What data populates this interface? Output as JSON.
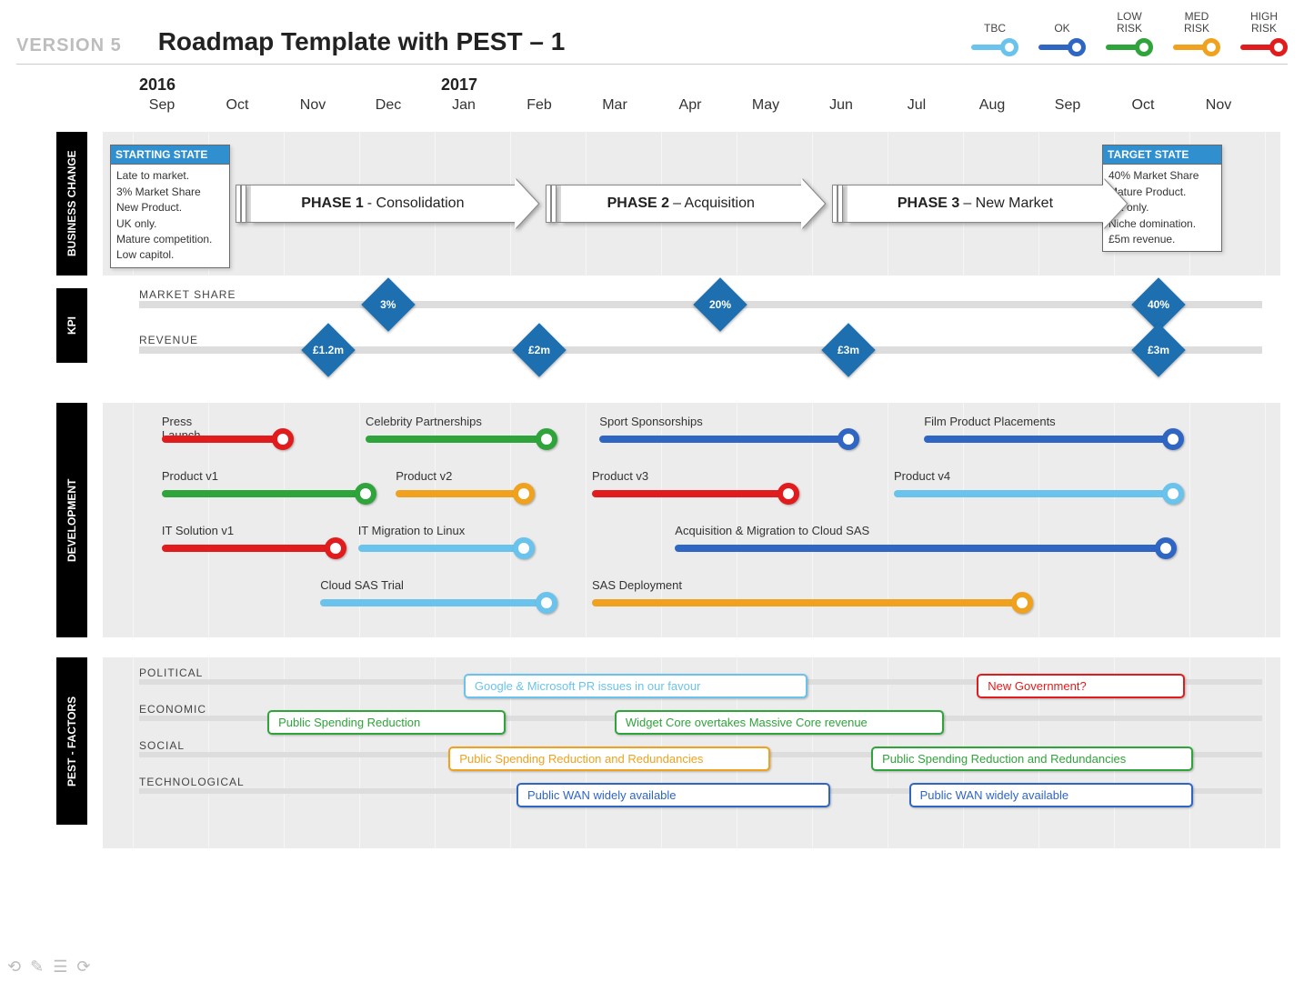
{
  "header": {
    "version": "VERSION 5",
    "title": "Roadmap Template with PEST – 1",
    "legend": [
      {
        "label": "TBC",
        "color": "#6ac3ec"
      },
      {
        "label": "OK",
        "color": "#2f66c4"
      },
      {
        "label": "LOW\nRISK",
        "color": "#2fa43a"
      },
      {
        "label": "MED\nRISK",
        "color": "#f0a21e"
      },
      {
        "label": "HIGH\nRISK",
        "color": "#e21c1c"
      }
    ]
  },
  "timeline": {
    "years": [
      {
        "label": "2016",
        "col": 0
      },
      {
        "label": "2017",
        "col": 4
      }
    ],
    "months": [
      "Sep",
      "Oct",
      "Nov",
      "Dec",
      "Jan",
      "Feb",
      "Mar",
      "Apr",
      "May",
      "Jun",
      "Jul",
      "Aug",
      "Sep",
      "Oct",
      "Nov"
    ]
  },
  "sections": {
    "business_change": {
      "label": "BUSINESS CHANGE",
      "starting_state": {
        "title": "STARTING STATE",
        "body": "Late to market.\n3% Market Share\nNew Product.\nUK only.\nMature competition.\nLow capitol."
      },
      "target_state": {
        "title": "TARGET STATE",
        "body": "40% Market Share\nMature Product.\nUK only.\nNiche domination.\n£5m revenue."
      },
      "phases": [
        {
          "name": "PHASE 1",
          "desc": " - Consolidation",
          "start_col": 1.4,
          "end_col": 5.2
        },
        {
          "name": "PHASE 2",
          "desc": " – Acquisition",
          "start_col": 5.5,
          "end_col": 9.0
        },
        {
          "name": "PHASE 3",
          "desc": " – New Market",
          "start_col": 9.3,
          "end_col": 13.0
        }
      ]
    },
    "kpi": {
      "label": "KPI",
      "rows": [
        {
          "label": "MARKET SHARE",
          "diamonds": [
            {
              "col": 3.3,
              "value": "3%"
            },
            {
              "col": 7.7,
              "value": "20%"
            },
            {
              "col": 13.5,
              "value": "40%"
            }
          ]
        },
        {
          "label": "REVENUE",
          "diamonds": [
            {
              "col": 2.5,
              "value": "£1.2m"
            },
            {
              "col": 5.3,
              "value": "£2m"
            },
            {
              "col": 9.4,
              "value": "£3m"
            },
            {
              "col": 13.5,
              "value": "£3m"
            }
          ]
        }
      ]
    },
    "development": {
      "label": "DEVELOPMENT",
      "tracks": [
        {
          "row": 0,
          "label": "Press\nLaunch",
          "start": 0.3,
          "end": 1.9,
          "color": "#e21c1c"
        },
        {
          "row": 0,
          "label": "Celebrity Partnerships",
          "start": 3.0,
          "end": 5.4,
          "color": "#2fa43a"
        },
        {
          "row": 0,
          "label": "Sport Sponsorships",
          "start": 6.1,
          "end": 9.4,
          "color": "#2f66c4"
        },
        {
          "row": 0,
          "label": "Film Product Placements",
          "start": 10.4,
          "end": 13.7,
          "color": "#2f66c4"
        },
        {
          "row": 1,
          "label": "Product v1",
          "start": 0.3,
          "end": 3.0,
          "color": "#2fa43a"
        },
        {
          "row": 1,
          "label": "Product v2",
          "start": 3.4,
          "end": 5.1,
          "color": "#f0a21e"
        },
        {
          "row": 1,
          "label": "Product  v3",
          "start": 6.0,
          "end": 8.6,
          "color": "#e21c1c"
        },
        {
          "row": 1,
          "label": "Product  v4",
          "start": 10.0,
          "end": 13.7,
          "color": "#6ac3ec"
        },
        {
          "row": 2,
          "label": "IT Solution v1",
          "start": 0.3,
          "end": 2.6,
          "color": "#e21c1c"
        },
        {
          "row": 2,
          "label": "IT  Migration to Linux",
          "start": 2.9,
          "end": 5.1,
          "color": "#6ac3ec"
        },
        {
          "row": 2,
          "label": "Acquisition & Migration to Cloud SAS",
          "start": 7.1,
          "end": 13.6,
          "color": "#2f66c4"
        },
        {
          "row": 3,
          "label": "Cloud SAS  Trial",
          "start": 2.4,
          "end": 5.4,
          "color": "#6ac3ec"
        },
        {
          "row": 3,
          "label": "SAS  Deployment",
          "start": 6.0,
          "end": 11.7,
          "color": "#f0a21e"
        }
      ]
    },
    "pest": {
      "label": "PEST - FACTORS",
      "rows": [
        "POLITICAL",
        "ECONOMIC",
        "SOCIAL",
        "TECHNOLOGICAL"
      ],
      "boxes": [
        {
          "row": 0,
          "label": "Google & Microsoft PR issues in our favour",
          "start": 4.3,
          "end": 9.1,
          "color": "#6ac3ec"
        },
        {
          "row": 0,
          "label": "New  Government?",
          "start": 11.1,
          "end": 14.1,
          "color": "#e21c1c"
        },
        {
          "row": 1,
          "label": "Public Spending Reduction",
          "start": 1.7,
          "end": 5.1,
          "color": "#2fa43a"
        },
        {
          "row": 1,
          "label": "Widget Core overtakes Massive Core revenue",
          "start": 6.3,
          "end": 10.9,
          "color": "#2fa43a"
        },
        {
          "row": 2,
          "label": "Public Spending Reduction and Redundancies",
          "start": 4.1,
          "end": 8.6,
          "color": "#f0a21e"
        },
        {
          "row": 2,
          "label": "Public Spending Reduction and Redundancies",
          "start": 9.7,
          "end": 14.2,
          "color": "#2fa43a"
        },
        {
          "row": 3,
          "label": "Public WAN widely available",
          "start": 5.0,
          "end": 9.4,
          "color": "#2f66c4"
        },
        {
          "row": 3,
          "label": "Public WAN widely available",
          "start": 10.2,
          "end": 14.2,
          "color": "#2f66c4"
        }
      ]
    }
  },
  "chart_data": {
    "type": "roadmap-gantt",
    "time_axis": {
      "start": "2016-09",
      "end": "2017-11",
      "unit": "month"
    },
    "months": [
      "2016-09",
      "2016-10",
      "2016-11",
      "2016-12",
      "2017-01",
      "2017-02",
      "2017-03",
      "2017-04",
      "2017-05",
      "2017-06",
      "2017-07",
      "2017-08",
      "2017-09",
      "2017-10",
      "2017-11"
    ],
    "risk_legend": {
      "TBC": "#6ac3ec",
      "OK": "#2f66c4",
      "LOW RISK": "#2fa43a",
      "MED RISK": "#f0a21e",
      "HIGH RISK": "#e21c1c"
    },
    "kpi": {
      "market_share": [
        {
          "month": "2016-12",
          "value_pct": 3
        },
        {
          "month": "2017-04",
          "value_pct": 20
        },
        {
          "month": "2017-10",
          "value_pct": 40
        }
      ],
      "revenue_gbp_m": [
        {
          "month": "2016-11",
          "value": 1.2
        },
        {
          "month": "2017-02",
          "value": 2
        },
        {
          "month": "2017-06",
          "value": 3
        },
        {
          "month": "2017-10",
          "value": 3
        }
      ]
    },
    "phases": [
      {
        "name": "PHASE 1 - Consolidation",
        "start": "2016-10",
        "end": "2017-02"
      },
      {
        "name": "PHASE 2 – Acquisition",
        "start": "2017-02",
        "end": "2017-06"
      },
      {
        "name": "PHASE 3 – New Market",
        "start": "2017-06",
        "end": "2017-10"
      }
    ],
    "development": [
      {
        "label": "Press Launch",
        "start": "2016-09",
        "end": "2016-10",
        "risk": "HIGH RISK"
      },
      {
        "label": "Celebrity Partnerships",
        "start": "2016-12",
        "end": "2017-02",
        "risk": "LOW RISK"
      },
      {
        "label": "Sport Sponsorships",
        "start": "2017-03",
        "end": "2017-06",
        "risk": "OK"
      },
      {
        "label": "Film Product Placements",
        "start": "2017-07",
        "end": "2017-10",
        "risk": "OK"
      },
      {
        "label": "Product v1",
        "start": "2016-09",
        "end": "2016-12",
        "risk": "LOW RISK"
      },
      {
        "label": "Product v2",
        "start": "2016-12",
        "end": "2017-02",
        "risk": "MED RISK"
      },
      {
        "label": "Product v3",
        "start": "2017-03",
        "end": "2017-05",
        "risk": "HIGH RISK"
      },
      {
        "label": "Product v4",
        "start": "2017-07",
        "end": "2017-10",
        "risk": "TBC"
      },
      {
        "label": "IT Solution v1",
        "start": "2016-09",
        "end": "2016-11",
        "risk": "HIGH RISK"
      },
      {
        "label": "IT Migration to Linux",
        "start": "2016-12",
        "end": "2017-02",
        "risk": "TBC"
      },
      {
        "label": "Acquisition & Migration to Cloud SAS",
        "start": "2017-04",
        "end": "2017-10",
        "risk": "OK"
      },
      {
        "label": "Cloud SAS Trial",
        "start": "2016-11",
        "end": "2017-02",
        "risk": "TBC"
      },
      {
        "label": "SAS Deployment",
        "start": "2017-03",
        "end": "2017-08",
        "risk": "MED RISK"
      }
    ],
    "pest_factors": [
      {
        "category": "POLITICAL",
        "label": "Google & Microsoft PR issues in our favour",
        "start": "2017-01",
        "end": "2017-06",
        "risk": "TBC"
      },
      {
        "category": "POLITICAL",
        "label": "New Government?",
        "start": "2017-08",
        "end": "2017-11",
        "risk": "HIGH RISK"
      },
      {
        "category": "ECONOMIC",
        "label": "Public Spending Reduction",
        "start": "2016-10",
        "end": "2017-02",
        "risk": "LOW RISK"
      },
      {
        "category": "ECONOMIC",
        "label": "Widget Core overtakes Massive Core revenue",
        "start": "2017-03",
        "end": "2017-07",
        "risk": "LOW RISK"
      },
      {
        "category": "SOCIAL",
        "label": "Public Spending Reduction and Redundancies",
        "start": "2017-01",
        "end": "2017-05",
        "risk": "MED RISK"
      },
      {
        "category": "SOCIAL",
        "label": "Public Spending Reduction and Redundancies",
        "start": "2017-06",
        "end": "2017-11",
        "risk": "LOW RISK"
      },
      {
        "category": "TECHNOLOGICAL",
        "label": "Public WAN widely available",
        "start": "2017-02",
        "end": "2017-06",
        "risk": "OK"
      },
      {
        "category": "TECHNOLOGICAL",
        "label": "Public WAN widely available",
        "start": "2017-07",
        "end": "2017-11",
        "risk": "OK"
      }
    ]
  }
}
